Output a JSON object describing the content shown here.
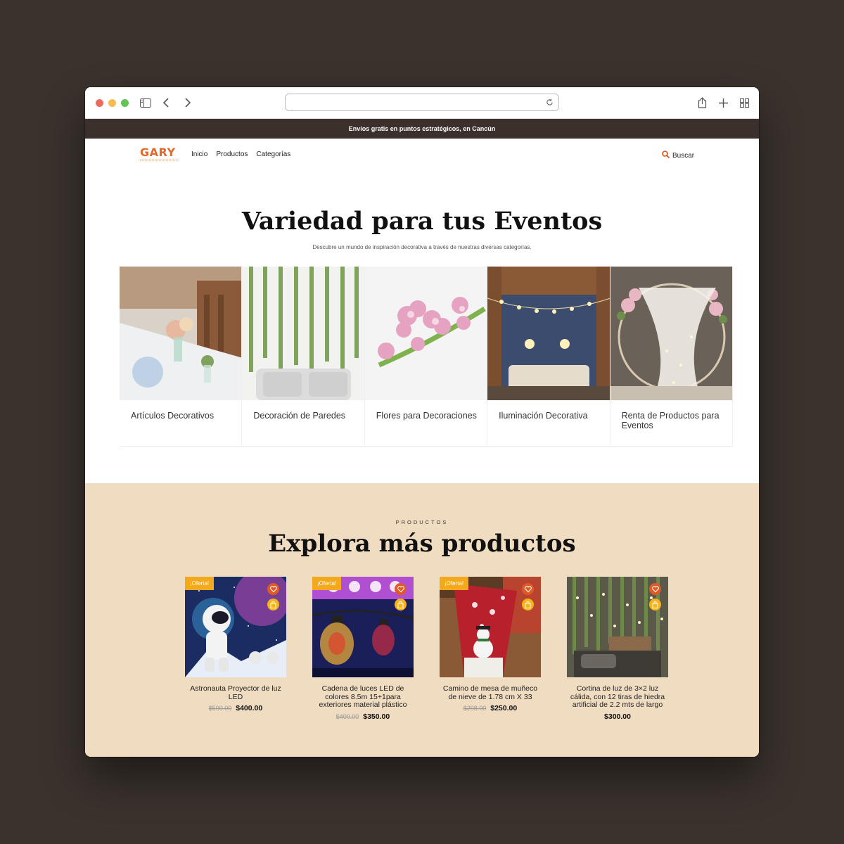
{
  "colors": {
    "background": "#3a322d",
    "announce_bar": "#3b302b",
    "brand_orange": "#e06a2b",
    "products_bg": "#f0dcc1",
    "badge": "#f3a91b"
  },
  "announce": {
    "text": "Envíos gratis en puntos estratégicos, en Cancún"
  },
  "header": {
    "logo": "GARY",
    "nav": [
      "Inicio",
      "Productos",
      "Categorías"
    ],
    "search_label": "Buscar"
  },
  "hero": {
    "title": "Variedad para tus Eventos",
    "subtitle": "Descubre un mundo de inspiración decorativa a través de nuestras diversas categorías."
  },
  "categories": [
    {
      "label": "Artículos Decorativos",
      "icon": "table-decor-photo"
    },
    {
      "label": "Decoración de Paredes",
      "icon": "ivy-wall-photo"
    },
    {
      "label": "Flores para Decoraciones",
      "icon": "pink-flowers-photo"
    },
    {
      "label": "Iluminación Decorativa",
      "icon": "string-lights-photo"
    },
    {
      "label": "Renta de Productos para Eventos",
      "icon": "arch-curtain-photo"
    }
  ],
  "products_section": {
    "eyebrow": "PRODUCTOS",
    "title": "Explora más productos",
    "items": [
      {
        "badge": "¡Oferta!",
        "name": "Astronauta Proyector de luz LED",
        "old_price": "$500.00",
        "price": "$400.00"
      },
      {
        "badge": "¡Oferta!",
        "name": "Cadena de luces LED de colores 8.5m 15+1para exteriores material plástico",
        "old_price": "$400.00",
        "price": "$350.00"
      },
      {
        "badge": "¡Oferta!",
        "name": "Camino de mesa de muñeco de nieve de 1.78 cm X 33",
        "old_price": "$298.00",
        "price": "$250.00"
      },
      {
        "badge": "",
        "name": "Cortina de luz de 3×2 luz cálida, con 12 tiras de hiedra artificial de 2.2 mts de largo",
        "old_price": "",
        "price": "$300.00"
      }
    ]
  }
}
